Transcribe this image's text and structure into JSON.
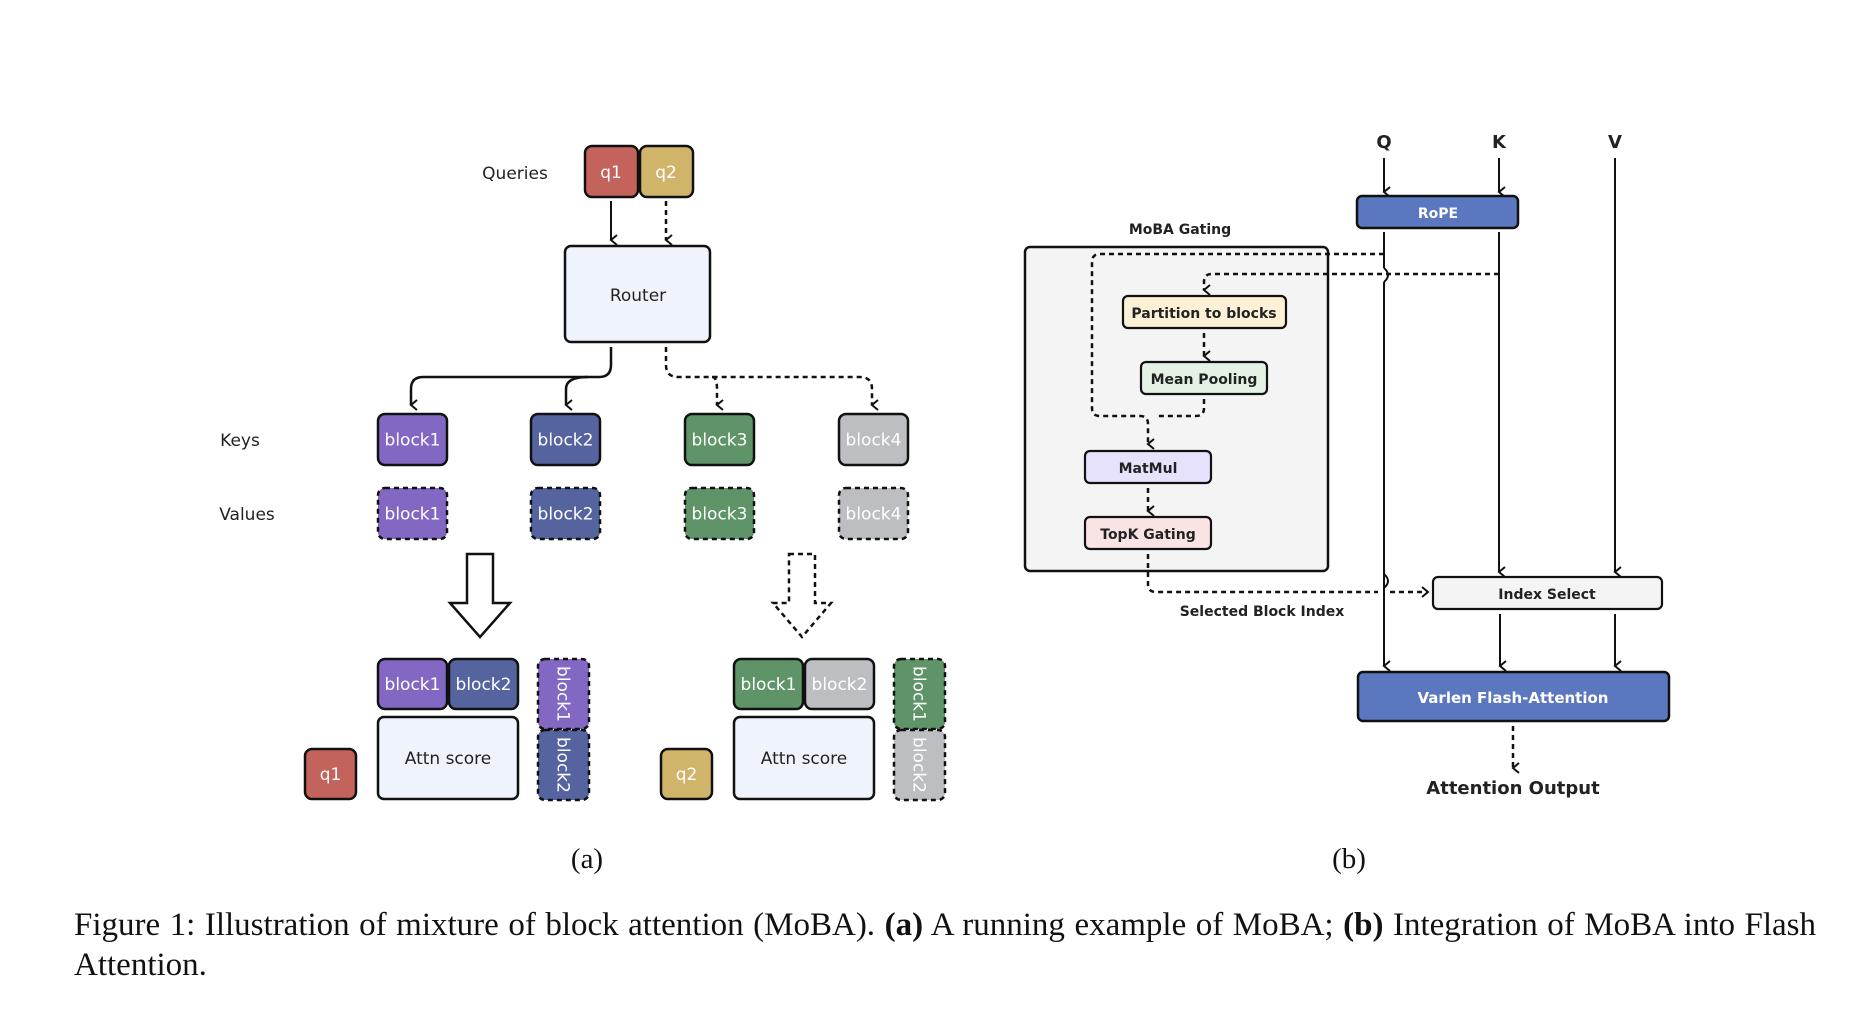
{
  "panel_a": {
    "queries_label": "Queries",
    "keys_label": "Keys",
    "values_label": "Values",
    "router_label": "Router",
    "queries": [
      {
        "label": "q1",
        "color": "#c4625c",
        "routing": "solid"
      },
      {
        "label": "q2",
        "color": "#d0b46a",
        "routing": "dashed"
      }
    ],
    "keys": [
      {
        "label": "block1",
        "color": "#8368c3"
      },
      {
        "label": "block2",
        "color": "#55649f"
      },
      {
        "label": "block3",
        "color": "#5f9468"
      },
      {
        "label": "block4",
        "color": "#bcbec2"
      }
    ],
    "values": [
      {
        "label": "block1",
        "color": "#8368c3"
      },
      {
        "label": "block2",
        "color": "#55649f"
      },
      {
        "label": "block3",
        "color": "#5f9468"
      },
      {
        "label": "block4",
        "color": "#bcbec2"
      }
    ],
    "results": [
      {
        "query": "q1",
        "query_color": "#c4625c",
        "score_label": "Attn score",
        "key_blocks": [
          {
            "label": "block1",
            "color": "#8368c3"
          },
          {
            "label": "block2",
            "color": "#55649f"
          }
        ],
        "value_blocks": [
          {
            "label": "block1",
            "color": "#8368c3"
          },
          {
            "label": "block2",
            "color": "#55649f"
          }
        ]
      },
      {
        "query": "q2",
        "query_color": "#d0b46a",
        "score_label": "Attn score",
        "key_blocks": [
          {
            "label": "block1",
            "color": "#5f9468"
          },
          {
            "label": "block2",
            "color": "#bcbec2"
          }
        ],
        "value_blocks": [
          {
            "label": "block1",
            "color": "#5f9468"
          },
          {
            "label": "block2",
            "color": "#bcbec2"
          }
        ]
      }
    ],
    "subcaption": "(a)"
  },
  "panel_b": {
    "inputs": [
      "Q",
      "K",
      "V"
    ],
    "rope_label": "RoPE",
    "gating_title": "MoBA Gating",
    "gating_steps": [
      {
        "label": "Partition to blocks",
        "color": "#fcf1d7"
      },
      {
        "label": "Mean Pooling",
        "color": "#e3f2e4"
      },
      {
        "label": "MatMul",
        "color": "#e6e2fb"
      },
      {
        "label": "TopK Gating",
        "color": "#fae4e3"
      }
    ],
    "selected_index_label": "Selected Block Index",
    "index_select_label": "Index Select",
    "flash_attention_label": "Varlen Flash-Attention",
    "output_label": "Attention Output",
    "accent_color": "#5b77c0",
    "subcaption": "(b)"
  },
  "caption": {
    "prefix": "Figure 1:  Illustration of mixture of block attention (MoBA). ",
    "a_tag": "(a)",
    "a_text": " A running example of MoBA; ",
    "b_tag": "(b)",
    "b_text": " Integration of MoBA into Flash Attention."
  }
}
